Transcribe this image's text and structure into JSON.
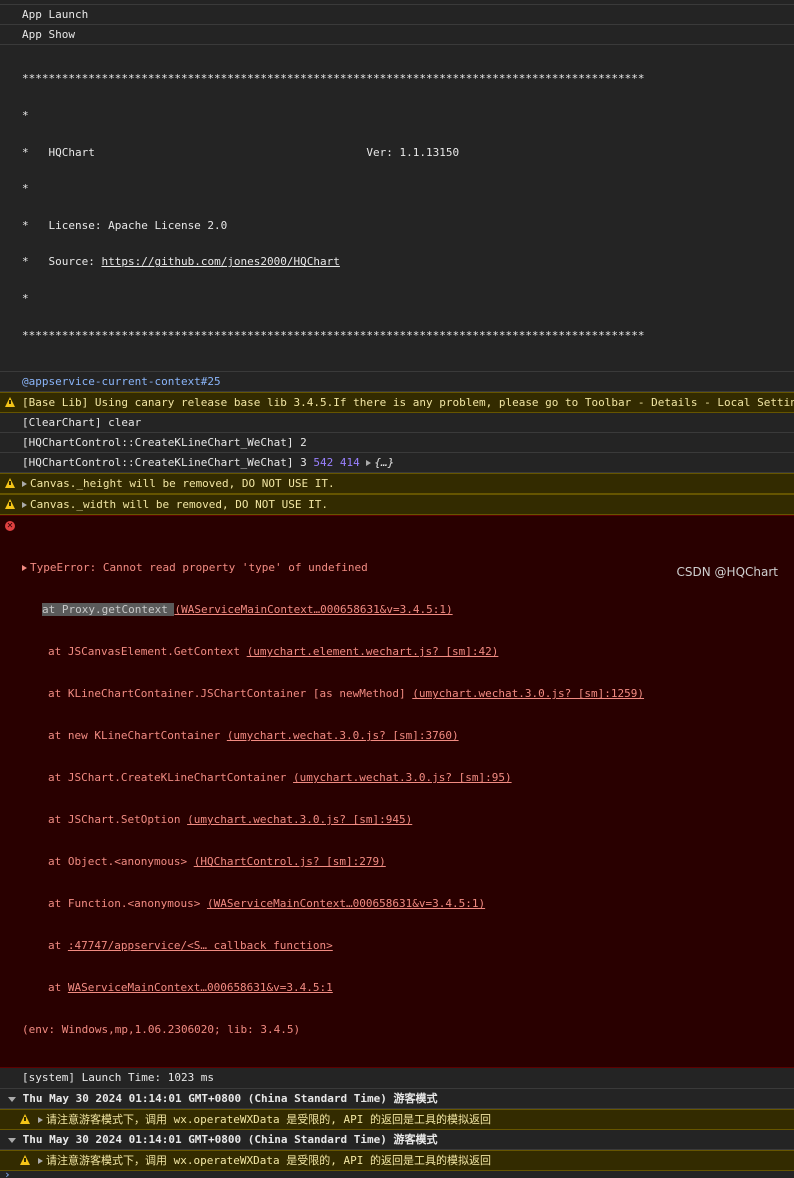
{
  "messages": {
    "app_launch": "App Launch",
    "app_show": "App Show",
    "banner_lines": [
      "**********************************************************************************************",
      "*",
      "*   HQChart                                         Ver: 1.1.13150",
      "*",
      "*   License: Apache License 2.0",
      "*   Source: ",
      "*",
      "**********************************************************************************************"
    ],
    "source_url": "https://github.com/jones2000/HQChart",
    "context_link": "@appservice-current-context#25",
    "base_lib_warning": "[Base Lib] Using canary release base lib 3.4.5.If there is any problem, please go to Toolbar - Details - Local Settings",
    "clear_chart": "[ClearChart] clear",
    "create_line_1": "[HQChartControl::CreateKLineChart_WeChat] 2",
    "create_line_2_prefix": "[HQChartControl::CreateKLineChart_WeChat] 3 ",
    "create_line_2_n1": "542",
    "create_line_2_n2": "414",
    "create_line_2_obj": "{…}",
    "warn_height": "Canvas._height will be removed, DO NOT USE IT.",
    "warn_width": "Canvas._width will be removed, DO NOT USE IT.",
    "error_title": "TypeError: Cannot read property 'type' of undefined",
    "stack": [
      {
        "text": "at Proxy.getContext ",
        "link": "(WAServiceMainContext…000658631&v=3.4.5:1)"
      },
      {
        "text": "at JSCanvasElement.GetContext ",
        "link": "(umychart.element.wechart.js? [sm]:42)"
      },
      {
        "text": "at KLineChartContainer.JSChartContainer [as newMethod] ",
        "link": "(umychart.wechat.3.0.js? [sm]:1259)"
      },
      {
        "text": "at new KLineChartContainer ",
        "link": "(umychart.wechat.3.0.js? [sm]:3760)"
      },
      {
        "text": "at JSChart.CreateKLineChartContainer ",
        "link": "(umychart.wechat.3.0.js? [sm]:95)"
      },
      {
        "text": "at JSChart.SetOption ",
        "link": "(umychart.wechat.3.0.js? [sm]:945)"
      },
      {
        "text": "at Object.<anonymous> ",
        "link": "(HQChartControl.js? [sm]:279)"
      },
      {
        "text": "at Function.<anonymous> ",
        "link": "(WAServiceMainContext…000658631&v=3.4.5:1)"
      },
      {
        "text": "at ",
        "link": ":47747/appservice/<S… callback function>"
      },
      {
        "text": "at ",
        "link": "WAServiceMainContext…000658631&v=3.4.5:1"
      }
    ],
    "env_line": "(env: Windows,mp,1.06.2306020; lib: 3.4.5)",
    "launch_time": "[system] Launch Time: 1023 ms",
    "group_title": "Thu May 30 2024 01:14:01 GMT+0800 (China Standard Time) 游客模式",
    "group_warning": "请注意游客模式下，调用 wx.operateWXData 是受限的, API 的返回是工具的模拟返回"
  },
  "watermark": "CSDN @HQChart",
  "colors": {
    "warning_bg": "#332b00",
    "error_bg": "#290000",
    "error_text": "#f28b82",
    "link_blue": "#8ab4f8",
    "number_purple": "#9980ff"
  }
}
